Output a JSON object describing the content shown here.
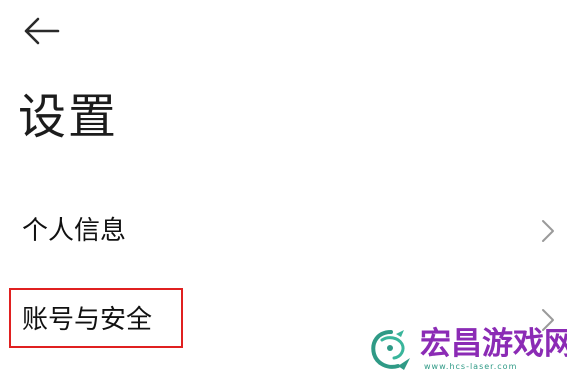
{
  "header": {
    "back_icon": "arrow-left-icon",
    "title": "设置"
  },
  "settings": {
    "items": [
      {
        "label": "个人信息",
        "icon": "chevron-right-icon",
        "highlighted": false
      },
      {
        "label": "账号与安全",
        "icon": "chevron-right-icon",
        "highlighted": true
      }
    ]
  },
  "annotation": {
    "highlight_color": "#e02020"
  },
  "watermark": {
    "name": "宏昌游戏网",
    "url": "www.hcs-laser.com",
    "name_color": "#8b2bb5",
    "logo_color": "#2f9a86",
    "logo_icon": "dragon-logo-icon"
  }
}
